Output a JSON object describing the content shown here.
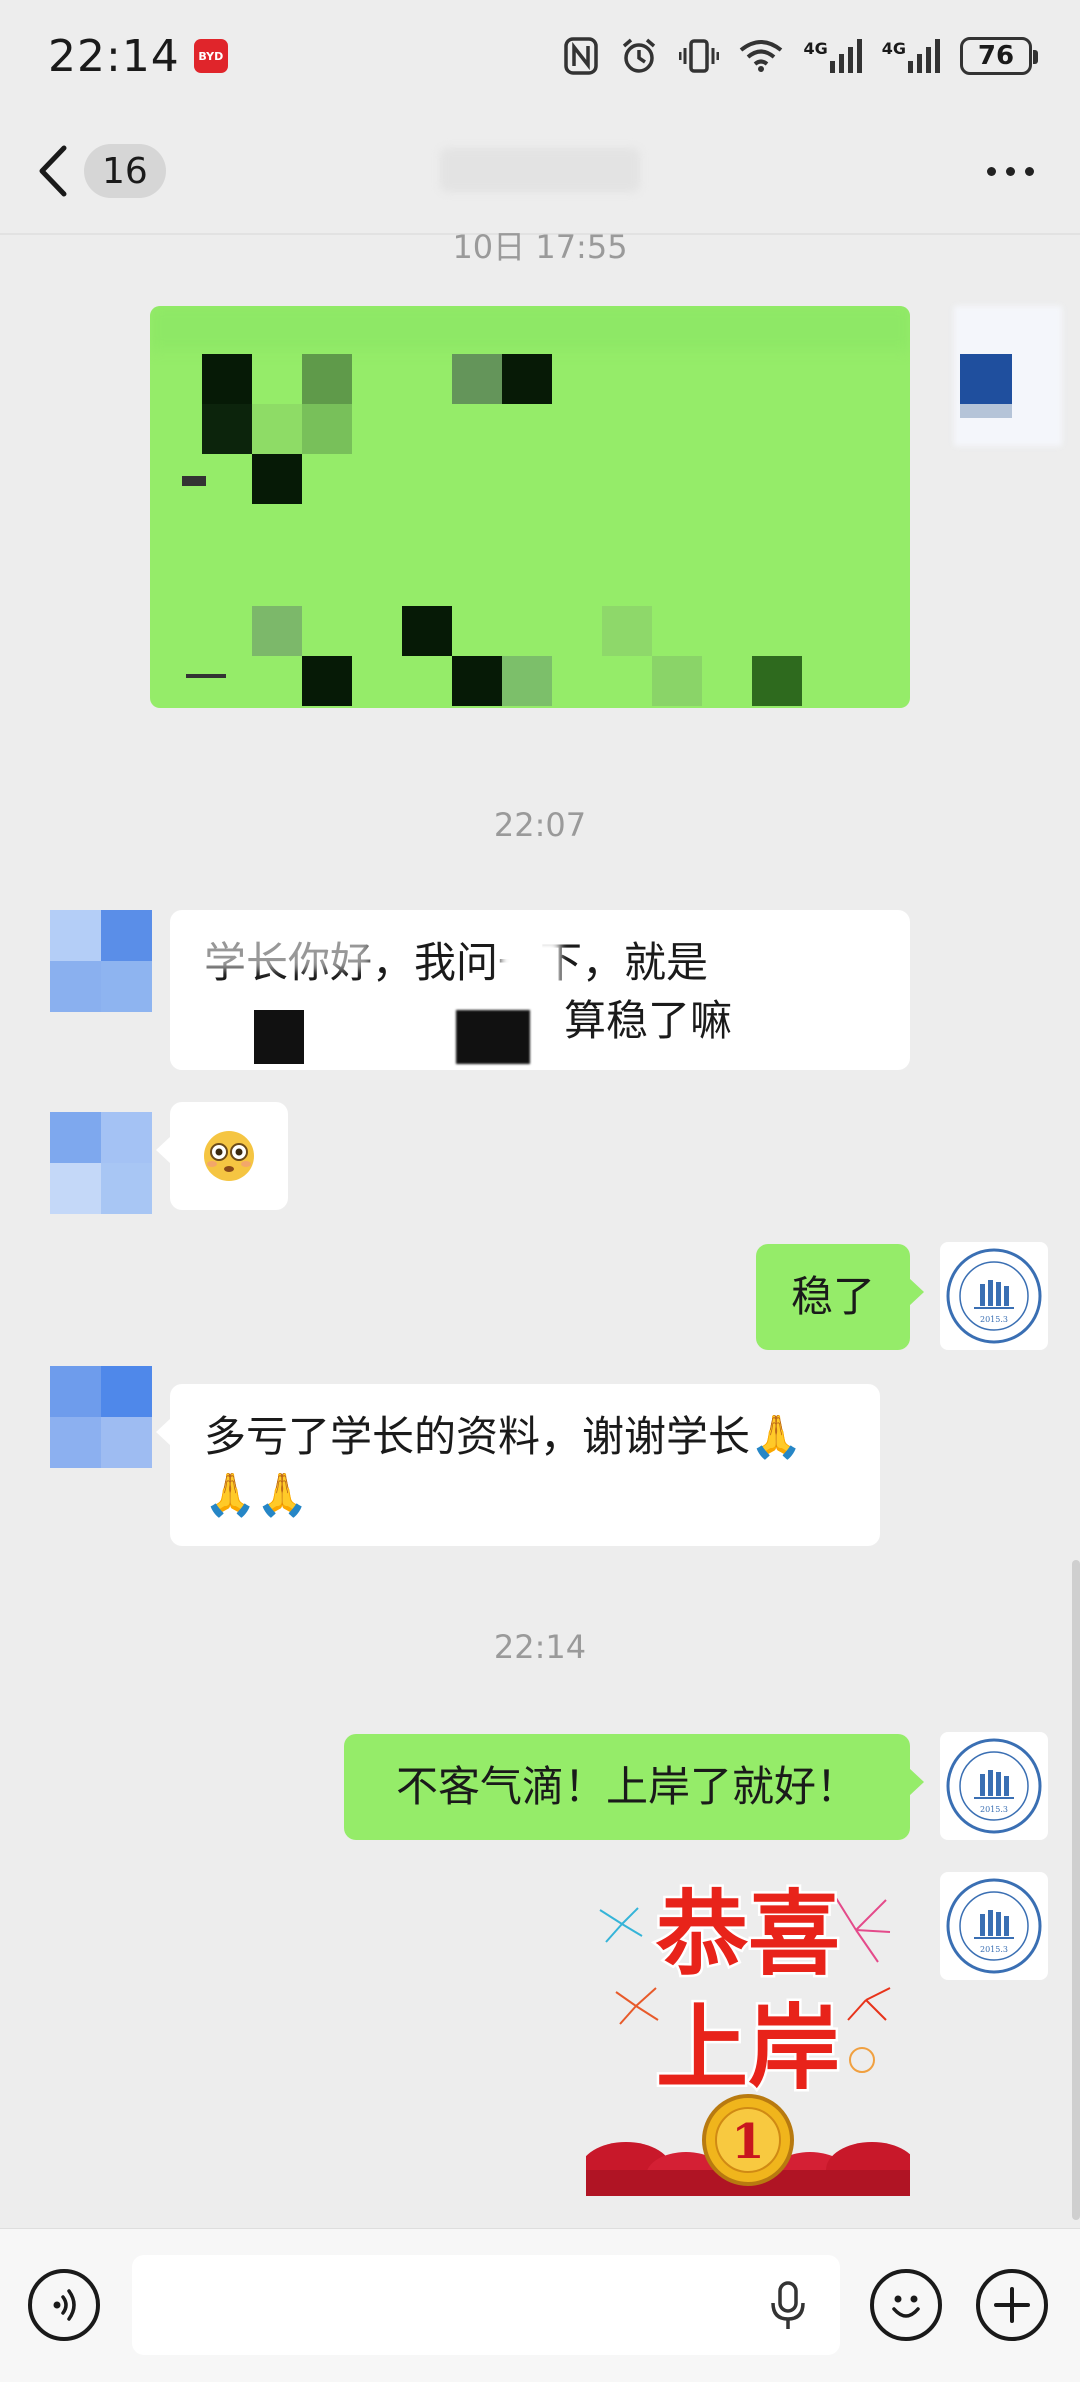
{
  "status_bar": {
    "time": "22:14",
    "app_badge": "BYD",
    "battery": "76",
    "network_1": "4G",
    "network_2": "4G"
  },
  "nav": {
    "unread_count": "16"
  },
  "chat": {
    "timestamps": [
      "10日 17:55",
      "22:07",
      "22:14"
    ],
    "messages": [
      {
        "side": "left",
        "line1": "学长你好，我问一下，就是",
        "line2": "算稳了嘛"
      },
      {
        "side": "left",
        "emoji": "😳"
      },
      {
        "side": "right",
        "text": "稳了"
      },
      {
        "side": "left",
        "line1": "多亏了学长的资料，谢谢学长🙏",
        "line2": "🙏🙏"
      },
      {
        "side": "right",
        "text": "不客气滴！上岸了就好！"
      }
    ],
    "sticker": {
      "line1": "恭喜",
      "line2": "上岸",
      "medal": "1"
    },
    "avatar_logo": {
      "ring_text": "LIU XUE ZHANG KAO YAN",
      "year": "2015.3"
    }
  },
  "input_bar": {
    "placeholder": ""
  },
  "colors": {
    "background": "#ededed",
    "bubble_self": "#95ec69",
    "bubble_other": "#ffffff",
    "avatar_blue": "#5a8ee8",
    "sticker_red": "#e8231a",
    "sticker_gold": "#f0b51c"
  }
}
